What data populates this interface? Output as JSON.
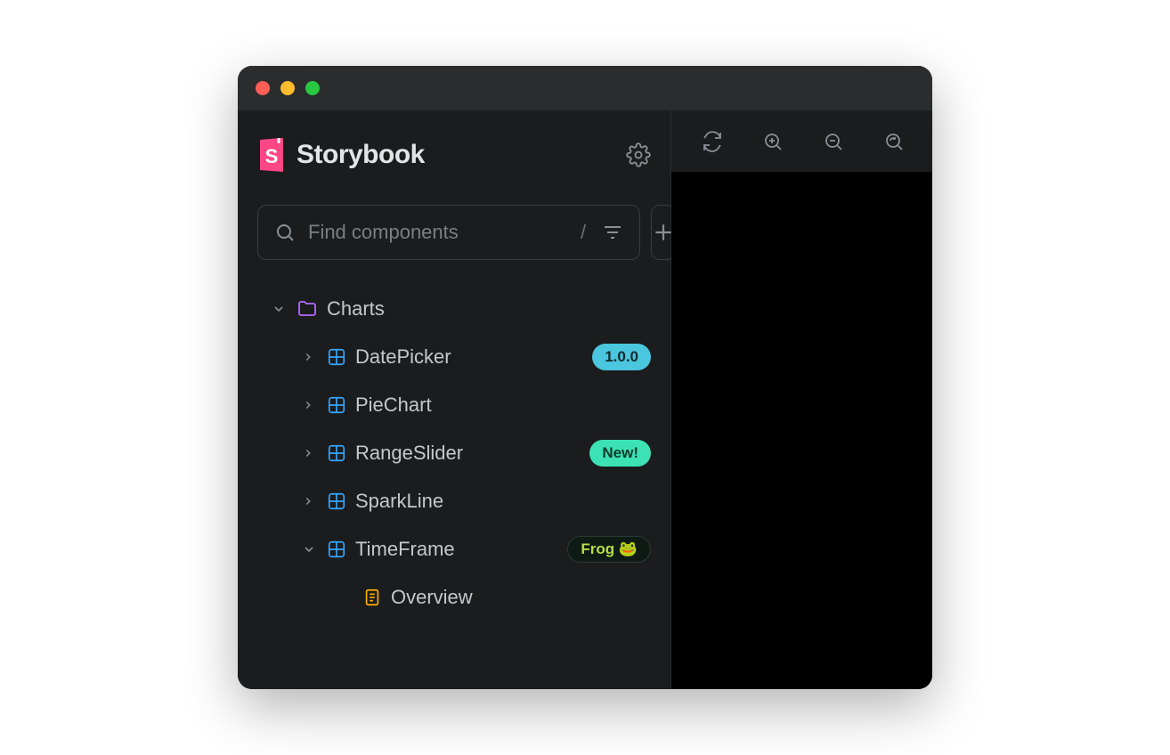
{
  "brand": {
    "title": "Storybook"
  },
  "search": {
    "placeholder": "Find components",
    "shortcut": "/"
  },
  "tree": {
    "folder": {
      "label": "Charts"
    },
    "items": [
      {
        "label": "DatePicker",
        "badge": "1.0.0",
        "badge_style": "cyan"
      },
      {
        "label": "PieChart"
      },
      {
        "label": "RangeSlider",
        "badge": "New!",
        "badge_style": "mint"
      },
      {
        "label": "SparkLine"
      },
      {
        "label": "TimeFrame",
        "badge": "Frog 🐸",
        "badge_style": "dark",
        "expanded": true
      }
    ],
    "story": {
      "label": "Overview"
    }
  }
}
